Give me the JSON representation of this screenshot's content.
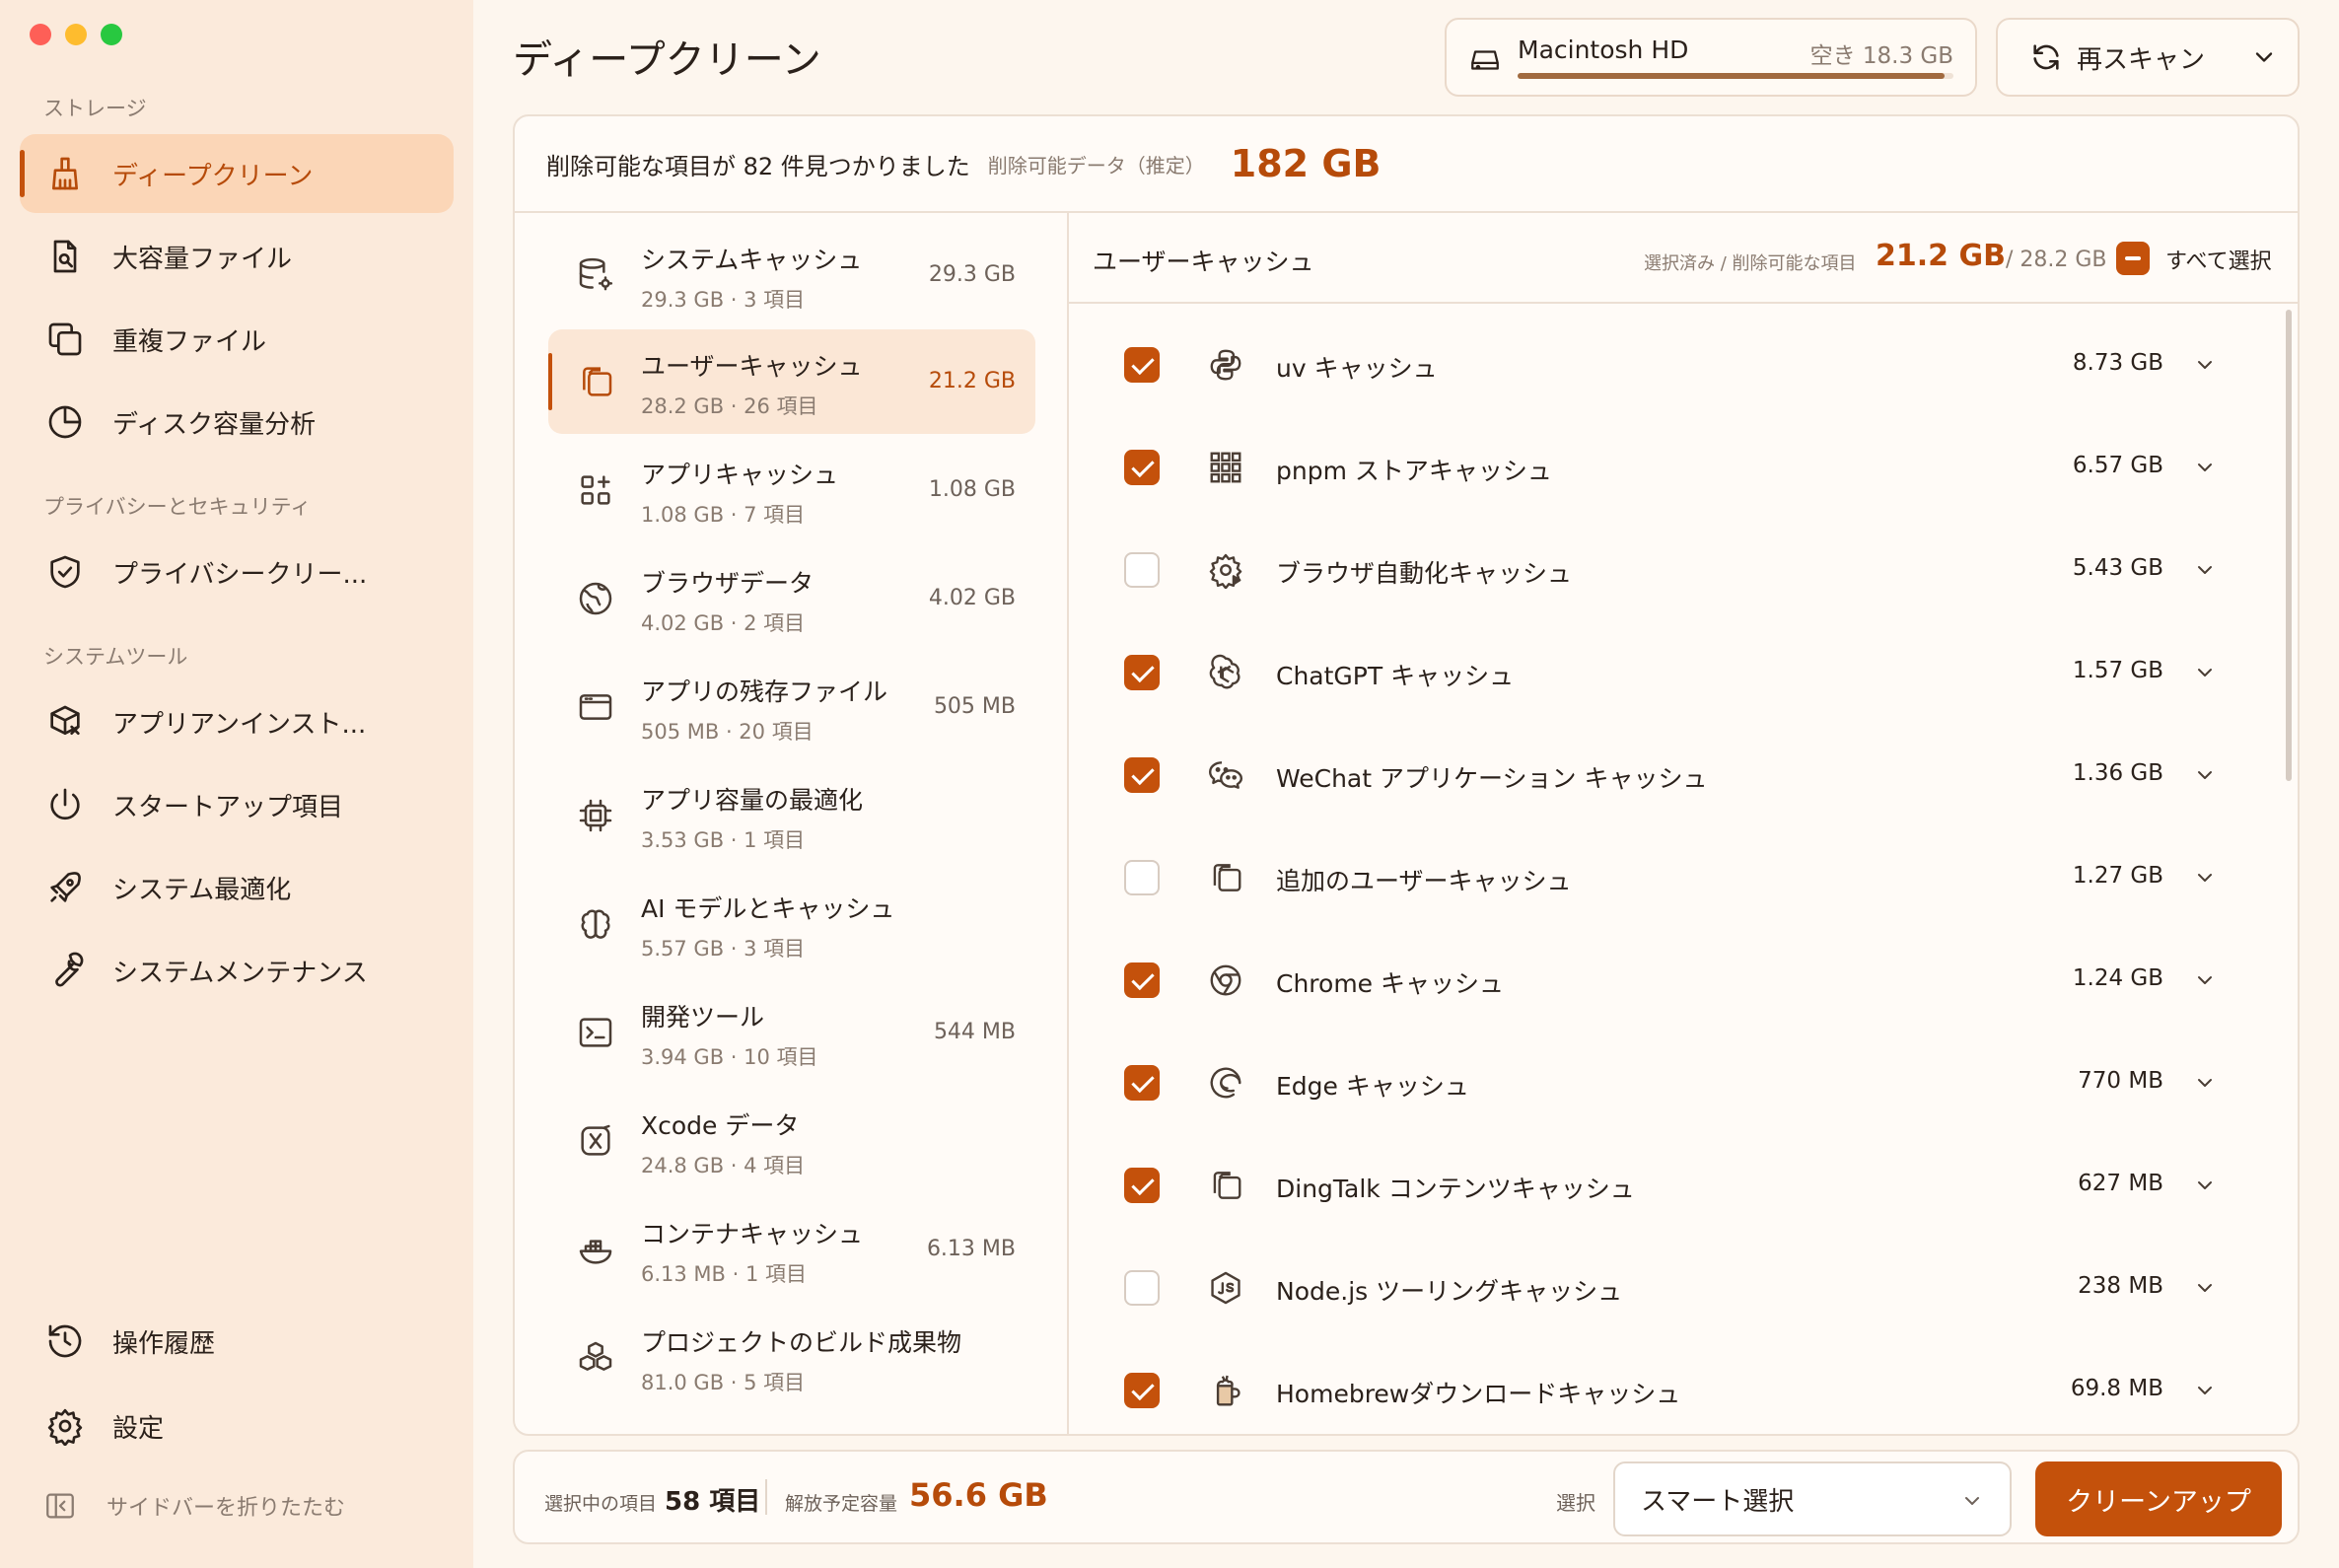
{
  "sidebar": {
    "sections": [
      "ストレージ",
      "プライバシーとセキュリティ",
      "システムツール"
    ],
    "items": [
      {
        "label": "ディープクリーン",
        "icon": "broom-icon"
      },
      {
        "label": "大容量ファイル",
        "icon": "large-file-icon"
      },
      {
        "label": "重複ファイル",
        "icon": "duplicate-icon"
      },
      {
        "label": "ディスク容量分析",
        "icon": "pie-chart-icon"
      },
      {
        "label": "プライバシークリー...",
        "icon": "shield-icon"
      },
      {
        "label": "アプリアンインスト...",
        "icon": "app-uninstall-icon"
      },
      {
        "label": "スタートアップ項目",
        "icon": "power-icon"
      },
      {
        "label": "システム最適化",
        "icon": "rocket-icon"
      },
      {
        "label": "システムメンテナンス",
        "icon": "wrench-icon"
      },
      {
        "label": "操作履歴",
        "icon": "history-icon"
      },
      {
        "label": "設定",
        "icon": "gear-icon"
      }
    ],
    "collapse_label": "サイドバーを折りたたむ"
  },
  "header": {
    "title": "ディープクリーン",
    "disk_name": "Macintosh HD",
    "disk_free": "空き 18.3 GB",
    "disk_used_fraction": 0.98,
    "rescan_label": "再スキャン"
  },
  "summary": {
    "found": "削除可能な項目が 82 件見つかりました",
    "estimate_label": "削除可能データ（推定）",
    "total": "182 GB"
  },
  "categories": [
    {
      "name": "システムキャッシュ",
      "sub": "29.3 GB · 3 項目",
      "size": "29.3 GB",
      "icon": "database-gear-icon"
    },
    {
      "name": "ユーザーキャッシュ",
      "sub": "28.2 GB · 26 項目",
      "size": "21.2 GB",
      "icon": "files-icon",
      "active": true
    },
    {
      "name": "アプリキャッシュ",
      "sub": "1.08 GB · 7 項目",
      "size": "1.08 GB",
      "icon": "apps-icon"
    },
    {
      "name": "ブラウザデータ",
      "sub": "4.02 GB · 2 項目",
      "size": "4.02 GB",
      "icon": "globe-icon"
    },
    {
      "name": "アプリの残存ファイル",
      "sub": "505 MB · 20 項目",
      "size": "505 MB",
      "icon": "window-icon"
    },
    {
      "name": "アプリ容量の最適化",
      "sub": "3.53 GB · 1 項目",
      "size": "",
      "icon": "chip-icon"
    },
    {
      "name": "AI モデルとキャッシュ",
      "sub": "5.57 GB · 3 項目",
      "size": "",
      "icon": "brain-icon"
    },
    {
      "name": "開発ツール",
      "sub": "3.94 GB · 10 項目",
      "size": "544 MB",
      "icon": "terminal-icon"
    },
    {
      "name": "Xcode データ",
      "sub": "24.8 GB · 4 項目",
      "size": "",
      "icon": "xcode-icon"
    },
    {
      "name": "コンテナキャッシュ",
      "sub": "6.13 MB · 1 項目",
      "size": "6.13 MB",
      "icon": "docker-icon"
    },
    {
      "name": "プロジェクトのビルド成果物",
      "sub": "81.0 GB · 5 項目",
      "size": "",
      "icon": "boxes-icon"
    }
  ],
  "items_panel": {
    "title": "ユーザーキャッシュ",
    "selected_label": "選択済み / 削除可能な項目",
    "selected_value": "21.2 GB",
    "selected_total": "/ 28.2 GB",
    "select_all_label": "すべて選択",
    "rows": [
      {
        "name": "uv キャッシュ",
        "size": "8.73 GB",
        "checked": true,
        "icon": "python-icon"
      },
      {
        "name": "pnpm ストアキャッシュ",
        "size": "6.57 GB",
        "checked": true,
        "icon": "pnpm-grid-icon"
      },
      {
        "name": "ブラウザ自動化キャッシュ",
        "size": "5.43 GB",
        "checked": false,
        "icon": "gear-play-icon"
      },
      {
        "name": "ChatGPT キャッシュ",
        "size": "1.57 GB",
        "checked": true,
        "icon": "openai-icon"
      },
      {
        "name": "WeChat アプリケーション キャッシュ",
        "size": "1.36 GB",
        "checked": true,
        "icon": "wechat-icon"
      },
      {
        "name": "追加のユーザーキャッシュ",
        "size": "1.27 GB",
        "checked": false,
        "icon": "files-icon"
      },
      {
        "name": "Chrome キャッシュ",
        "size": "1.24 GB",
        "checked": true,
        "icon": "chrome-icon"
      },
      {
        "name": "Edge キャッシュ",
        "size": "770 MB",
        "checked": true,
        "icon": "edge-icon"
      },
      {
        "name": "DingTalk コンテンツキャッシュ",
        "size": "627 MB",
        "checked": true,
        "icon": "files-icon"
      },
      {
        "name": "Node.js ツーリングキャッシュ",
        "size": "238 MB",
        "checked": false,
        "icon": "nodejs-icon"
      },
      {
        "name": "Homebrewダウンロードキャッシュ",
        "size": "69.8 MB",
        "checked": true,
        "icon": "homebrew-icon"
      }
    ]
  },
  "footer": {
    "selected_label": "選択中の項目",
    "selected_count": "58 項目",
    "free_label": "解放予定容量",
    "free_value": "56.6 GB",
    "select_label": "選択",
    "select_value": "スマート選択",
    "clean_label": "クリーンアップ"
  },
  "colors": {
    "accent": "#c4510b",
    "sidebar_bg": "#fbeadb",
    "active_bg": "#fbd6b7"
  }
}
